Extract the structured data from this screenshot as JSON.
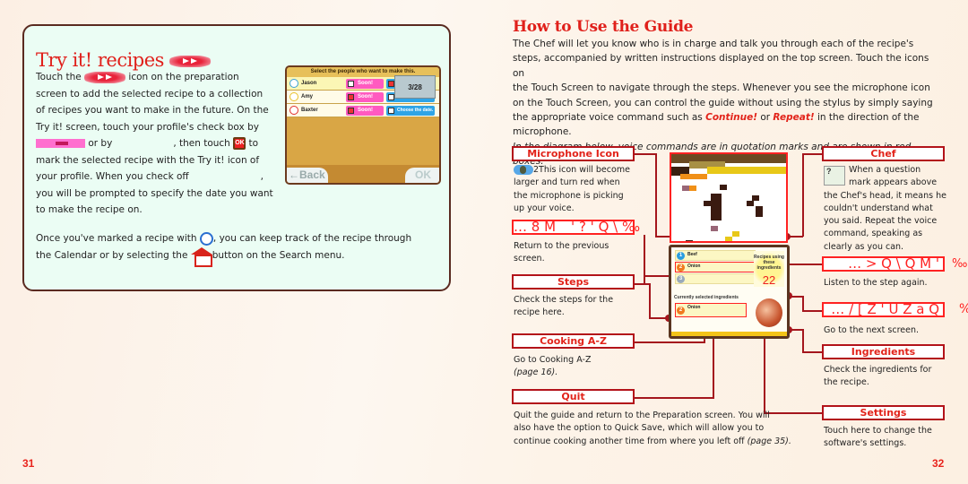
{
  "left_page": {
    "title": "Try it! recipes",
    "para1": {
      "l1a": "Touch the",
      "l1b": "icon on the preparation",
      "l2": "screen to add the selected recipe to a collection",
      "l3": "of recipes you want to make in the future. On the",
      "l4": "Try it! screen, touch your profile's check box by",
      "l5a": "or by",
      "l5b": ", then touch",
      "l5c": "to",
      "l6": "mark the selected recipe with the Try it! icon of",
      "l7a": "your profile. When you check off",
      "l7b": ",",
      "l8": "you will be prompted to specify the date you want",
      "l9": "to make the recipe on."
    },
    "para2": {
      "l1a": "Once you've marked a recipe with",
      "l1b": ", you can keep track of the recipe through",
      "l2a": "the Calendar or by selecting the",
      "l2b": "button on the Search menu."
    },
    "ok_icon_label": "OK",
    "screen": {
      "header": "Select the people who want to make this.",
      "rows": [
        {
          "name": "Jason",
          "soon": "Soon!",
          "soon_checked": false,
          "date": "",
          "date_checked": true
        },
        {
          "name": "Amy",
          "soon": "Soon!",
          "soon_checked": true,
          "date": "Choose the date.",
          "date_checked": false
        },
        {
          "name": "Baxter",
          "soon": "Soon!",
          "soon_checked": true,
          "date": "Choose the date.",
          "date_checked": false
        }
      ],
      "date_spinner": "3/28",
      "back_label": "←Back",
      "ok_label": "OK"
    },
    "page_number": "31"
  },
  "right_page": {
    "title": "How to Use the Guide",
    "intro": {
      "l1": "The Chef will let you know who is in charge and talk you through each of the recipe's",
      "l2": "steps, accompanied by written instructions displayed on the top screen. Touch the icons on",
      "l3": "the Touch Screen to navigate through the steps. Whenever you see the microphone icon",
      "l4": "on the Touch Screen, you can control the guide without using the stylus by simply saying",
      "l5a": "the appropriate voice command such as",
      "cmd1": "Continue!",
      "l5b": "or",
      "cmd2": "Repeat!",
      "l5c": "in the direction of the",
      "l6": "microphone.",
      "note": "In the diagram below, voice commands are in quotation marks and are shown in red boxes."
    },
    "callouts": {
      "microphone": {
        "label": "Microphone Icon",
        "text_prefix": "2",
        "desc": [
          "This icon will become",
          "larger and turn red when",
          "the microphone is picking",
          "up your voice."
        ]
      },
      "back_voice": {
        "label": "… 8 M _ '   ? ' Q \\   ‰",
        "desc": [
          "Return to the previous",
          "screen."
        ]
      },
      "steps": {
        "label": "Steps",
        "desc": [
          "Check the steps for the",
          "recipe here."
        ]
      },
      "cooking": {
        "label": "Cooking A-Z",
        "desc": [
          "Go to Cooking A-Z"
        ],
        "page_ref": "(page 16)."
      },
      "quit": {
        "label": "Quit",
        "desc": [
          "Quit the guide and return to the Preparation screen. You will",
          "also have the option to Quick Save, which will allow you to"
        ],
        "desc_last": "continue cooking another time from where you left off",
        "page_ref": "(page 35)."
      },
      "chef": {
        "label": "Chef",
        "desc_wrap": [
          "When a question",
          "mark appears above"
        ],
        "desc": [
          "the Chef's head, it means he",
          "couldn't understand what",
          "you said. Repeat the voice",
          "command, speaking as",
          "clearly as you can."
        ]
      },
      "repeat_voice": {
        "label": "… > Q \\ Q M '",
        "tail": "‰",
        "desc": [
          "Listen to the step again."
        ]
      },
      "continue_voice": {
        "label": "… / [ Z ' U Z a Q",
        "tail": "%",
        "desc": [
          "Go to the next screen."
        ]
      },
      "ingredients": {
        "label": "Ingredients",
        "desc": [
          "Check the ingredients for",
          "the recipe."
        ]
      },
      "settings": {
        "label": "Settings",
        "desc": [
          "Touch here to change the",
          "software's settings."
        ]
      }
    },
    "guide_screen": {
      "ingredients": [
        {
          "num": "1",
          "name": "Beef",
          "color": "#2a9de0"
        },
        {
          "num": "2",
          "name": "Onion",
          "color": "#f07a1e"
        },
        {
          "num": "3",
          "name": "",
          "color": "#9ab"
        }
      ],
      "recipes_label": "Recipes using these ingredients",
      "recipes_count": "22",
      "current_label": "Currently selected ingredients",
      "current": {
        "num": "2",
        "name": "Onion"
      }
    },
    "page_number": "32"
  }
}
